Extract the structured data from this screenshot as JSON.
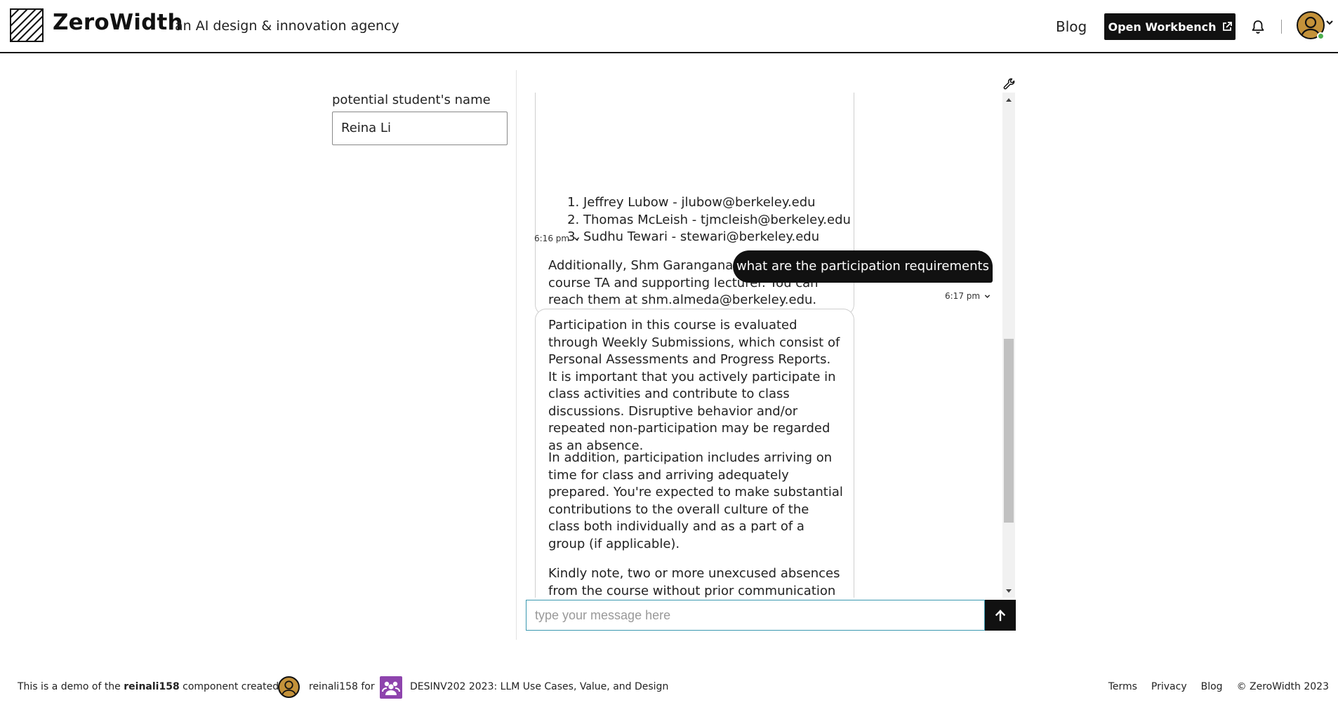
{
  "header": {
    "brand": "ZeroWidth",
    "tagline": "an AI design & innovation agency",
    "nav_blog": "Blog",
    "workbench_label": "Open Workbench"
  },
  "form": {
    "label": "potential student's name",
    "value": "Reina Li"
  },
  "chat": {
    "bot_message_1": {
      "list": [
        "Jeffrey Lubow - jlubow@berkeley.edu",
        "Thomas McLeish - tjmcleish@berkeley.edu",
        "Sudhu Tewari - stewari@berkeley.edu"
      ],
      "extra": "Additionally, Shm Garanganao Almeda is the course TA and supporting lecturer. You can reach them at shm.almeda@berkeley.edu."
    },
    "timestamp_1": "6:16 pm",
    "user_message": "what are the participation requirements",
    "timestamp_2": "6:17 pm",
    "bot_message_2": {
      "p1": "Participation in this course is evaluated through Weekly Submissions, which consist of Personal Assessments and Progress Reports. It is important that you actively participate in class activities and contribute to class discussions. Disruptive behavior and/or repeated non-participation may be regarded as an absence.",
      "p2": "In addition, participation includes arriving on time for class and arriving adequately prepared. You're expected to make substantial contributions to the overall culture of the class both individually and as a part of a group (if applicable).",
      "p3": "Kindly note, two or more unexcused absences from the course without prior communication"
    },
    "composer_placeholder": "type your message here"
  },
  "footer": {
    "demo_prefix": "This is a demo of the",
    "component_name": "reinali158",
    "demo_suffix": "component created by",
    "creator": "reinali158",
    "for_text": "for",
    "course": "DESINV202 2023: LLM Use Cases, Value, and Design",
    "links": [
      "Terms",
      "Privacy",
      "Blog",
      "© ZeroWidth 2023"
    ]
  },
  "colors": {
    "accent_dark": "#111111",
    "composer_border": "#3a98b0",
    "online": "#4caf50",
    "avatar": "#c4923a",
    "org": "#8e44ad"
  }
}
